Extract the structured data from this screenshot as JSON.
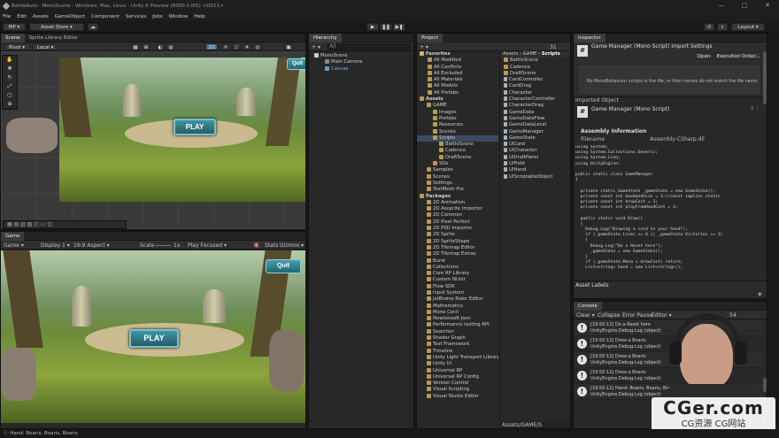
{
  "window": {
    "title": "BattleAuto - MenuScene - Windows, Mac, Linux - Unity 6 Preview (6000.0.0f1) <DX11>",
    "min": "—",
    "max": "□",
    "close": "✕"
  },
  "menu": [
    "File",
    "Edit",
    "Assets",
    "GameObject",
    "Component",
    "Services",
    "Jobs",
    "Window",
    "Help"
  ],
  "toolbar": {
    "account": "MP ▾",
    "store": "Asset Store ▾",
    "play": "▶",
    "pause": "❚❚",
    "step": "▶❚",
    "layout": "Layout ▾",
    "history": "↺",
    "search": "⌕"
  },
  "scene_panel": {
    "tabs": [
      "Scene",
      "Sprite Library Editor"
    ],
    "pivot": "Pivot ▾",
    "local": "Local ▾",
    "mode": "2D"
  },
  "scene_view": {
    "play_label": "PLAY",
    "quit_label": "Quit"
  },
  "game_panel": {
    "tab": "Game",
    "mode": "Game ▾",
    "display": "Display 1 ▾",
    "aspect": "16:9 Aspect ▾",
    "scale": "Scale",
    "scale_value": "1x",
    "play_focused": "Play Focused ▾",
    "stats": "Stats",
    "gizmos": "Gizmos ▾",
    "play_label": "PLAY",
    "quit_label": "Quit"
  },
  "hierarchy": {
    "title": "Hierarchy",
    "add": "+ ▾",
    "search_placeholder": "All",
    "items": [
      "MenuScene",
      "Main Camera",
      "Canvas"
    ]
  },
  "project": {
    "title": "Project",
    "breadcrumb": [
      "Assets",
      "GAME",
      "Scripts"
    ],
    "count": "31",
    "favorites_label": "Favorites",
    "favorites": [
      "All Modified",
      "All Conflicts",
      "All Excluded",
      "All Materials",
      "All Models",
      "All Prefabs"
    ],
    "assets_label": "Assets",
    "assets_tree": [
      {
        "label": "GAME",
        "d": 1
      },
      {
        "label": "Images",
        "d": 2
      },
      {
        "label": "Prefabs",
        "d": 2
      },
      {
        "label": "Resources",
        "d": 2
      },
      {
        "label": "Scenes",
        "d": 2
      },
      {
        "label": "Scripts",
        "d": 2,
        "sel": true
      },
      {
        "label": "BattleScene",
        "d": 3
      },
      {
        "label": "Cadence",
        "d": 3
      },
      {
        "label": "DraftScene",
        "d": 3
      },
      {
        "label": "SOs",
        "d": 2
      },
      {
        "label": "Samples",
        "d": 1
      },
      {
        "label": "Scenes",
        "d": 1
      },
      {
        "label": "Settings",
        "d": 1
      },
      {
        "label": "TextMesh Pro",
        "d": 1
      }
    ],
    "packages_label": "Packages",
    "packages": [
      "2D Animation",
      "2D Aseprite Importer",
      "2D Common",
      "2D Pixel Perfect",
      "2D PSD Importer",
      "2D Sprite",
      "2D SpriteShape",
      "2D Tilemap Editor",
      "2D Tilemap Extras",
      "Burst",
      "Collections",
      "Core RP Library",
      "Custom NUnit",
      "Flow SDK",
      "Input System",
      "JetBrains Rider Editor",
      "Mathematics",
      "Mono Cecil",
      "Newtonsoft Json",
      "Performance testing API",
      "Searcher",
      "Shader Graph",
      "Test Framework",
      "Timeline",
      "Unity Light Transport Library",
      "Unity UI",
      "Universal RP",
      "Universal RP Config",
      "Version Control",
      "Visual Scripting",
      "Visual Studio Editor"
    ],
    "files": [
      "BattleScene",
      "Cadence",
      "DraftScene",
      "CardController",
      "CardDrag",
      "Character",
      "CharacterController",
      "CharacterDrag",
      "GameData",
      "GameDataFlow",
      "GameDataLocal",
      "GameManager",
      "GameState",
      "UICard",
      "UICharacter",
      "UIDraftPanel",
      "UIField",
      "UIHand",
      "UIScriptableObject"
    ],
    "footer": "Assets/GAME/S"
  },
  "inspector": {
    "title": "Inspector",
    "header": "Game Manager (Mono Script) Import Settings",
    "open_button": "Open",
    "exec_button": "Execution Order...",
    "warning": "No MonoBehaviour scripts in the file, or their names do not match the file name.",
    "imported_label": "Imported Object",
    "script_title": "Game Manager (Mono Script)",
    "assembly_label": "Assembly Information",
    "filename_label": "Filename",
    "filename_value": "Assembly-CSharp.dll",
    "code": [
      "using System;",
      "using System.Collections.Generic;",
      "using System.Linq;",
      "using UnityEngine;",
      "",
      "public static class GameManager",
      "{",
      "",
      "  private static GameState _gameState = new GameState();",
      "  private const int maxHandSize = 3;//const implies static",
      "  private const int drawCost = 1;",
      "  private const int playFromHandCost = 3;",
      "",
      "  public static void Draw()",
      "  {",
      "    Debug.Log(\"Drawing a card to your hand\");",
      "    if (_gameState.Lives <= 0 || _gameState.Victories >= 3)",
      "    {",
      "      Debug.Log(\"Do a Reset here\");",
      "      _gameState = new GameState();",
      "    }",
      "    if (_gameState.Mana < drawCost) return;",
      "    List<string> hand = new List<string>();"
    ],
    "labels_title": "Asset Labels"
  },
  "console": {
    "title": "Console",
    "clear": "Clear ▾",
    "collapse": "Collapse",
    "error_pause": "Error Pause",
    "editor": "Editor ▾",
    "count": "54",
    "logs": [
      {
        "line1": "[19:50:12] Do a Reset here",
        "line2": "UnityEngine.Debug:Log (object)"
      },
      {
        "line1": "[19:50:12] Drew a Boaris",
        "line2": "UnityEngine.Debug:Log (object)"
      },
      {
        "line1": "[19:50:12] Drew a Boaris",
        "line2": "UnityEngine.Debug:Log (object)"
      },
      {
        "line1": "[19:50:12] Drew a Boaris",
        "line2": "UnityEngine.Debug:Log (object)"
      },
      {
        "line1": "[19:50:12] Hand: Boaris, Boaris, Boaris",
        "line2": "UnityEngine.Debug:Log (object)"
      }
    ]
  },
  "statusbar": {
    "text": "Hand: Boaris, Boaris, Boaris"
  },
  "watermark": {
    "main": "CGer.com",
    "sub": "CG资源 CG网站"
  }
}
